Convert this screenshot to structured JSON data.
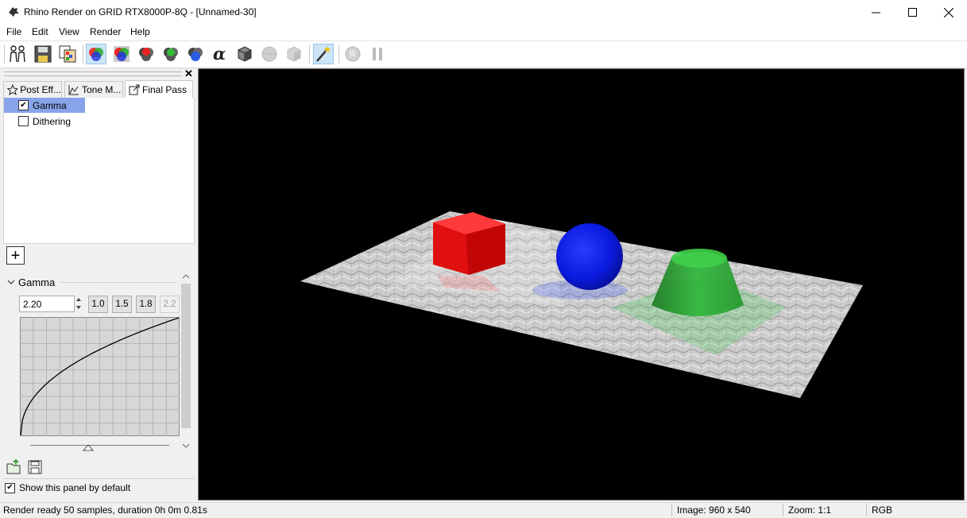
{
  "window": {
    "title": "Rhino Render on GRID RTX8000P-8Q - [Unnamed-30]"
  },
  "menu": [
    "File",
    "Edit",
    "View",
    "Render",
    "Help"
  ],
  "toolbar": {
    "icons": [
      "clone-window-icon",
      "save-icon",
      "compare-icon",
      "rgb-channels-icon",
      "rgb-alpha-channels-icon",
      "red-channel-icon",
      "green-channel-icon",
      "blue-channel-icon",
      "alpha-channel-icon",
      "monochrome-icon",
      "disabled-sphere-icon",
      "disabled-cube-icon",
      "post-effects-icon",
      "stop-render-icon",
      "pause-render-icon"
    ]
  },
  "panel": {
    "tabs": [
      {
        "label": "Post Eff...",
        "icon": "star-icon"
      },
      {
        "label": "Tone M...",
        "icon": "curve-icon"
      },
      {
        "label": "Final Pass",
        "icon": "export-icon"
      }
    ],
    "effects": [
      {
        "label": "Gamma",
        "checked": true,
        "selected": true
      },
      {
        "label": "Dithering",
        "checked": false,
        "selected": false
      }
    ],
    "gamma": {
      "section_title": "Gamma",
      "value": "2.20",
      "presets": [
        "1.0",
        "1.5",
        "1.8",
        "2.2"
      ],
      "curve_gamma": 2.2
    },
    "show_by_default_label": "Show this panel by default",
    "show_by_default_checked": true
  },
  "status": {
    "message": "Render ready 50 samples, duration 0h 0m 0.81s",
    "image_size": "Image: 960 x 540",
    "zoom": "Zoom: 1:1",
    "channel": "RGB"
  }
}
